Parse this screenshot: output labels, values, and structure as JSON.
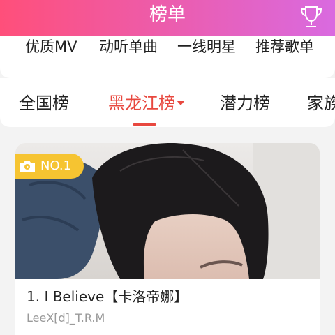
{
  "header": {
    "title": "榜单"
  },
  "sub_categories": [
    "优质MV",
    "动听单曲",
    "一线明星",
    "推荐歌单"
  ],
  "tabs": [
    {
      "label": "全国榜",
      "active": false
    },
    {
      "label": "黑龙江榜",
      "active": true
    },
    {
      "label": "潜力榜",
      "active": false
    },
    {
      "label": "家族",
      "active": false
    }
  ],
  "card": {
    "badge": "NO.1",
    "title": "1. I Believe【卡洛帝娜】",
    "artist": "LeeX[d]_T.R.M"
  },
  "colors": {
    "accent": "#e8483f",
    "header_start": "#ff4f7a",
    "header_end": "#d96ae0",
    "badge": "#f6c431"
  },
  "icons": {
    "header_right": "trophy-icon",
    "badge": "video-camera-icon",
    "tab_dropdown": "caret-down-icon"
  }
}
